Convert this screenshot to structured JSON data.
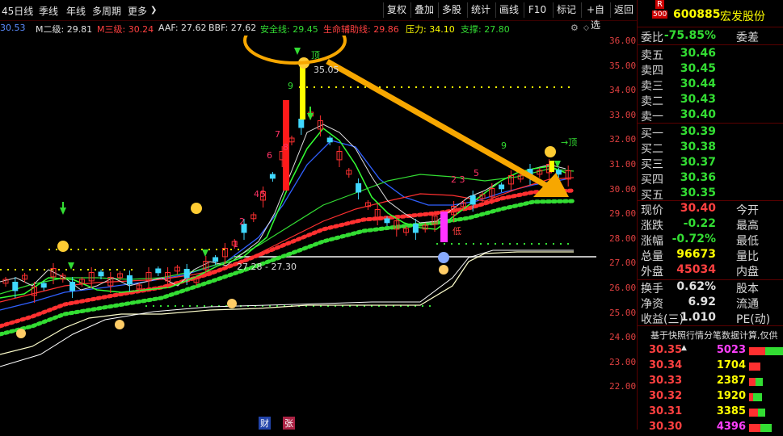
{
  "toolbar": {
    "periods": [
      "45日线",
      "季线",
      "年线",
      "多周期",
      "更多"
    ],
    "more_arrow": "❯",
    "buttons": [
      "复权",
      "叠加",
      "多股",
      "统计",
      "画线",
      "F10",
      "标记",
      "+自选",
      "返回"
    ]
  },
  "indicators": [
    {
      "label": "30.53",
      "color": "#5b8cff"
    },
    {
      "label": "M二级: 29.81",
      "color": "#e0e0e0"
    },
    {
      "label": "M三级: 30.24",
      "color": "#ff4040"
    },
    {
      "label": "AAF: 27.62",
      "color": "#e0e0e0"
    },
    {
      "label": "BBF: 27.62",
      "color": "#e0e0e0"
    },
    {
      "label": "安全线: 29.45",
      "color": "#33dd33"
    },
    {
      "label": "生命辅助线: 29.86",
      "color": "#ff4040"
    },
    {
      "label": "压力: 34.10",
      "color": "#ffff00"
    },
    {
      "label": "支撑: 27.80",
      "color": "#33dd33"
    }
  ],
  "y_axis": {
    "ticks": [
      "36.00",
      "35.00",
      "34.00",
      "33.00",
      "32.00",
      "31.00",
      "30.00",
      "29.00",
      "28.00",
      "27.00",
      "26.00",
      "25.00",
      "24.00",
      "23.00",
      "22.00"
    ]
  },
  "annotations": {
    "high_label": "35.05",
    "top_tag": "顶",
    "top_tag2": "→顶",
    "low_range": "27.28 - 27.30",
    "bottom_tag": "低",
    "nums": [
      "9",
      "8",
      "7",
      "6",
      "5",
      "4",
      "2",
      "1",
      "9",
      "2 3",
      "5"
    ],
    "bottom_tabs": [
      "财",
      "张"
    ]
  },
  "quote": {
    "badge_top": "R",
    "badge_bottom": "500",
    "code": "600885",
    "name": "宏发股份",
    "weibi_label": "委比",
    "weibi_value": "-75.85%",
    "weicha_label": "委差",
    "asks": [
      {
        "label": "卖五",
        "price": "30.46"
      },
      {
        "label": "卖四",
        "price": "30.45"
      },
      {
        "label": "卖三",
        "price": "30.44"
      },
      {
        "label": "卖二",
        "price": "30.43"
      },
      {
        "label": "卖一",
        "price": "30.40"
      }
    ],
    "bids": [
      {
        "label": "买一",
        "price": "30.39"
      },
      {
        "label": "买二",
        "price": "30.38"
      },
      {
        "label": "买三",
        "price": "30.37"
      },
      {
        "label": "买四",
        "price": "30.36"
      },
      {
        "label": "买五",
        "price": "30.35"
      }
    ],
    "stats": [
      {
        "l1": "现价",
        "v1": "30.40",
        "c1": "#ff4040",
        "l2": "今开"
      },
      {
        "l1": "涨跌",
        "v1": "-0.22",
        "c1": "#33dd33",
        "l2": "最高"
      },
      {
        "l1": "涨幅",
        "v1": "-0.72%",
        "c1": "#33dd33",
        "l2": "最低"
      },
      {
        "l1": "总量",
        "v1": "96673",
        "c1": "#ffff00",
        "l2": "量比"
      },
      {
        "l1": "外盘",
        "v1": "45034",
        "c1": "#ff4040",
        "l2": "内盘"
      }
    ],
    "stats2": [
      {
        "l1": "换手",
        "v1": "0.62%",
        "l2": "股本"
      },
      {
        "l1": "净资",
        "v1": "6.92",
        "l2": "流通"
      },
      {
        "l1": "收益(三)",
        "v1": "1.010",
        "l2": "PE(动)"
      }
    ],
    "note": "基于快照行情分笔数据计算,仅供",
    "ticks": [
      {
        "price": "30.35",
        "vol": "5023",
        "vcolor": "#ff40ff",
        "arrow": "▲",
        "bar": [
          0.45,
          0.55
        ]
      },
      {
        "price": "30.34",
        "vol": "1704",
        "vcolor": "#ffff00",
        "arrow": "",
        "bar": [
          0.3,
          0
        ]
      },
      {
        "price": "30.33",
        "vol": "2387",
        "vcolor": "#ffff00",
        "arrow": "",
        "bar": [
          0.18,
          0.2
        ]
      },
      {
        "price": "30.32",
        "vol": "1920",
        "vcolor": "#ffff00",
        "arrow": "",
        "bar": [
          0.1,
          0.25
        ]
      },
      {
        "price": "30.31",
        "vol": "3385",
        "vcolor": "#ffff00",
        "arrow": "",
        "bar": [
          0.25,
          0.2
        ]
      },
      {
        "price": "30.30",
        "vol": "4396",
        "vcolor": "#ff40ff",
        "arrow": "",
        "bar": [
          0.3,
          0.3
        ]
      }
    ]
  }
}
